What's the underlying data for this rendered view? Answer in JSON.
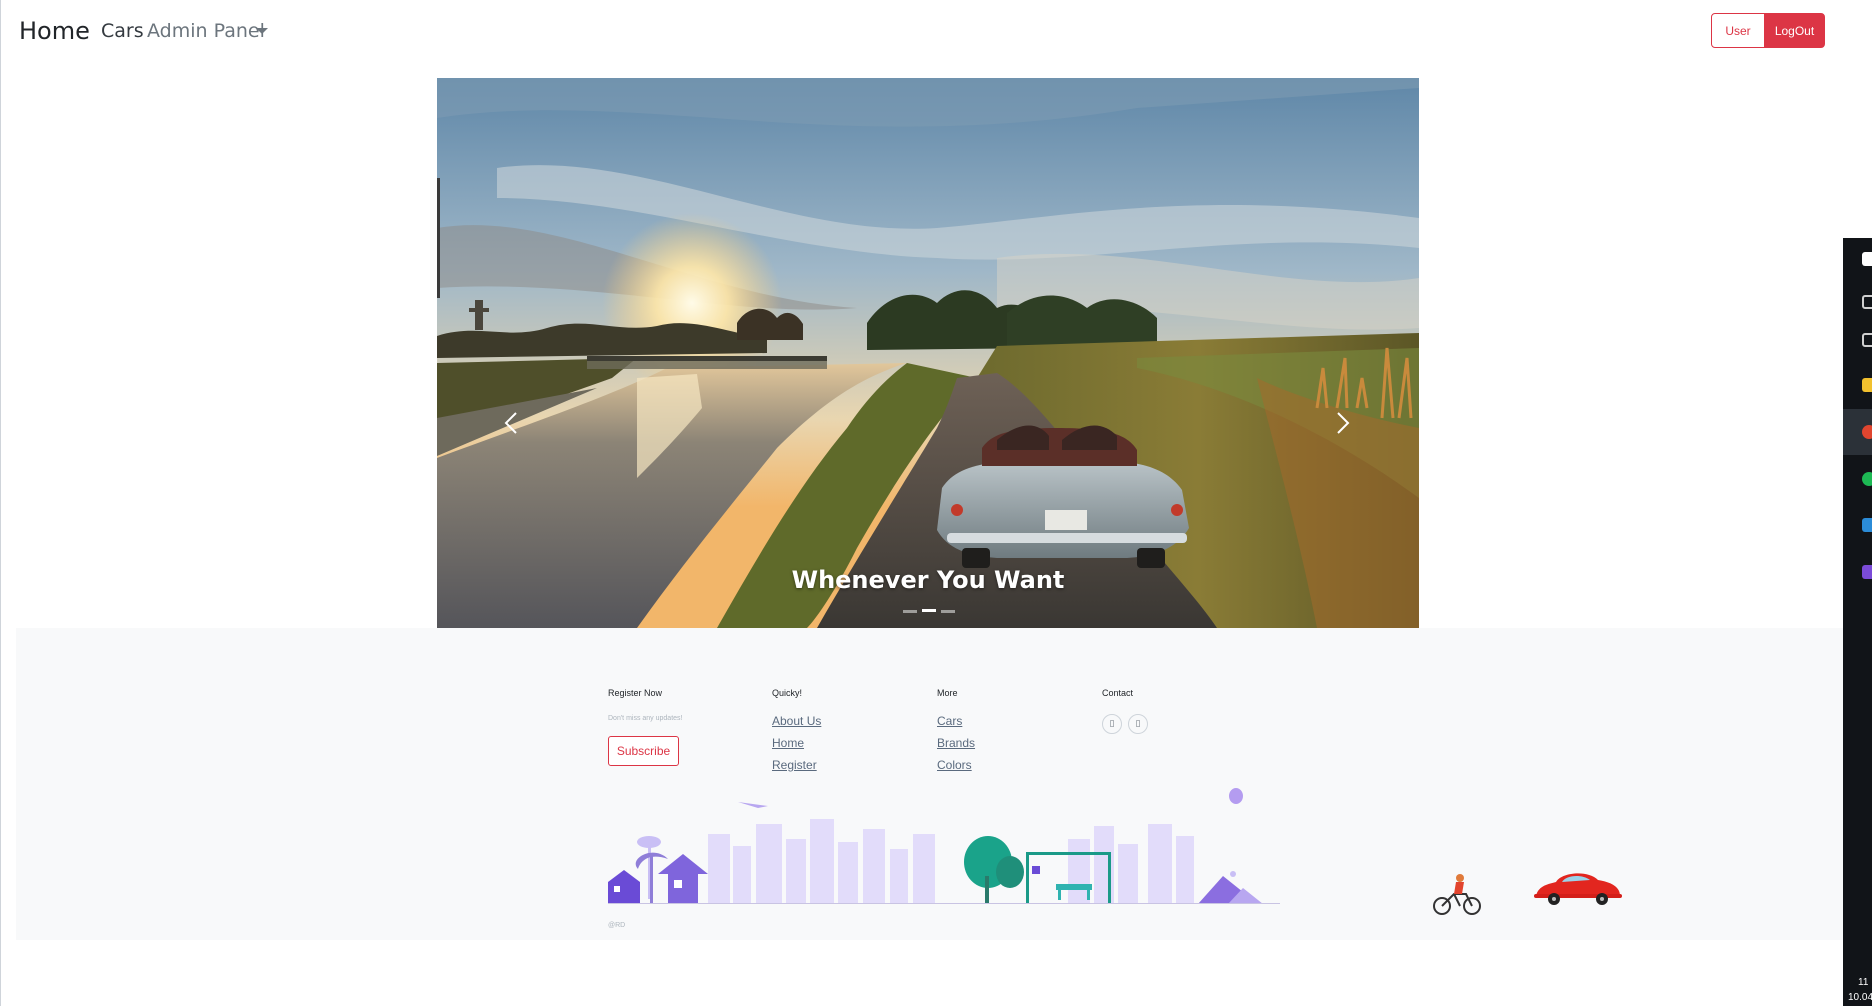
{
  "navbar": {
    "brand": "Home",
    "cars": "Cars",
    "admin_panel": "Admin Panel",
    "user_button": "User",
    "logout_button": "LogOut"
  },
  "carousel": {
    "caption": "Whenever You Want",
    "slide_count": 3,
    "active_slide_index": 1
  },
  "footer": {
    "register": {
      "title": "Register Now",
      "subtitle": "Don't miss any updates!",
      "button": "Subscribe"
    },
    "quick": {
      "title": "Quicky!",
      "links": [
        "About Us",
        "Home",
        "Register"
      ]
    },
    "more": {
      "title": "More",
      "links": [
        "Cars",
        "Brands",
        "Colors"
      ]
    },
    "contact": {
      "title": "Contact",
      "icons": [
        "facebook-icon",
        "instagram-icon"
      ]
    },
    "copyright": "@RD"
  },
  "taskbar": {
    "clock_time": "11",
    "clock_date": "10.04"
  },
  "colors": {
    "accent": "#dc3545",
    "footer_bg": "#f8f9fa",
    "link": "#5a6a7e"
  }
}
